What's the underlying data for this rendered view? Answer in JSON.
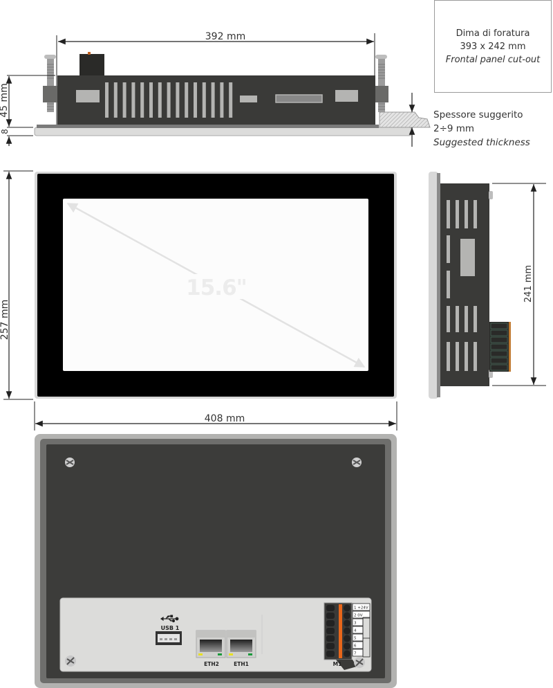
{
  "top_view": {
    "width_dimension": "392 mm",
    "depth_dimension": "45 mm",
    "bezel_dimension": "8"
  },
  "cutout_note": {
    "line1": "Dima di foratura",
    "line2": "393 x 242 mm",
    "line3": "Frontal panel cut-out"
  },
  "thickness_note": {
    "line1": "Spessore suggerito",
    "line2": "2÷9 mm",
    "line3": "Suggested thickness"
  },
  "front_view": {
    "height_dimension": "257 mm",
    "width_dimension": "408 mm",
    "diagonal_label": "15.6\""
  },
  "side_view": {
    "height_dimension": "241 mm"
  },
  "rear_view": {
    "usb_label": "USB 1",
    "eth_ports": [
      "ETH2",
      "ETH1"
    ],
    "terminal_label": "M1",
    "terminal_pins": [
      "1  +24V",
      "2  0V",
      "3",
      "4",
      "5",
      "6",
      "7"
    ]
  },
  "colors": {
    "housing": "#3a3a38",
    "vent": "#b4b4b2",
    "bezel": "#000000",
    "frame": "#d6d6d4",
    "terminal_orange": "#e8661a",
    "led_yellow": "#e8e020",
    "led_green": "#1a9a3a"
  }
}
